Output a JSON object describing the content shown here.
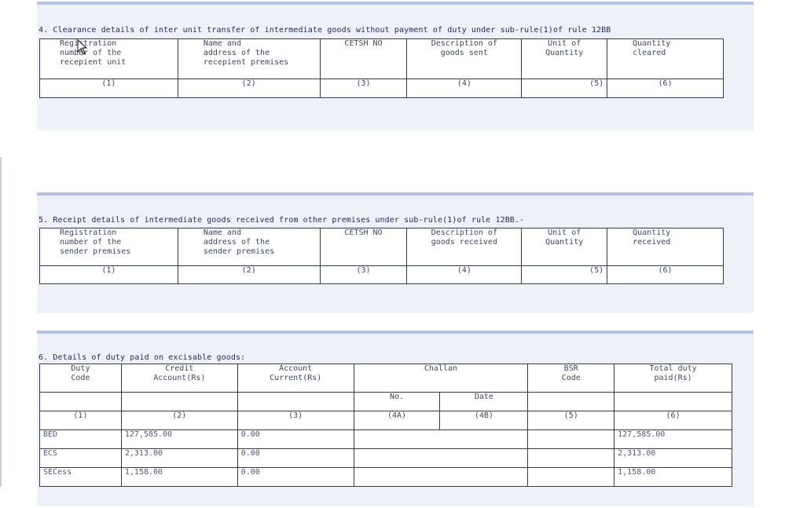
{
  "section4": {
    "title": "4. Clearance details of inter unit transfer of intermediate goods without payment of duty under sub-rule(1)of rule 12BB",
    "headers": [
      "Registration\nnumber of the\nrecepient unit",
      "Name and\naddress of the\nrecepient premises",
      "CETSH NO",
      "Description of\ngoods sent",
      "Unit of\nQuantity",
      "Quantity\ncleared"
    ],
    "numbers": [
      "(1)",
      "(2)",
      "(3)",
      "(4)",
      "(5)",
      "(6)"
    ]
  },
  "section5": {
    "title": "5. Receipt details of intermediate goods received from other premises under sub-rule(1)of rule 12BB.-",
    "headers": [
      "Registration\nnumber of the\nsender premises",
      "Name and\naddress of the\nsender premises",
      "CETSH NO",
      "Description of\ngoods received",
      "Unit of\nQuantity",
      "Quantity\nreceived"
    ],
    "numbers": [
      "(1)",
      "(2)",
      "(3)",
      "(4)",
      "(5)",
      "(6)"
    ]
  },
  "section6": {
    "title": "6. Details of duty paid on excisable goods:",
    "headers": {
      "duty_code": "Duty\nCode",
      "credit_account": "Credit\nAccount(Rs)",
      "account_current": "Account\nCurrent(Rs)",
      "challan": "Challan",
      "challan_no": "No.",
      "challan_date": "Date",
      "bsr_code": "BSR\nCode",
      "total_duty": "Total duty\npaid(Rs)"
    },
    "numbers": [
      "(1)",
      "(2)",
      "(3)",
      "(4A)",
      "(4B)",
      "(5)",
      "(6)"
    ],
    "rows": [
      {
        "code": "BED",
        "credit": "127,585.00",
        "current": "0.00",
        "no": "",
        "date": "",
        "bsr": "",
        "total": "127,585.00"
      },
      {
        "code": "ECS",
        "credit": "2,313.00",
        "current": "0.00",
        "no": "",
        "date": "",
        "bsr": "",
        "total": "2,313.00"
      },
      {
        "code": "SECess",
        "credit": "1,158.00",
        "current": "0.00",
        "no": "",
        "date": "",
        "bsr": "",
        "total": "1,158.00"
      }
    ]
  }
}
